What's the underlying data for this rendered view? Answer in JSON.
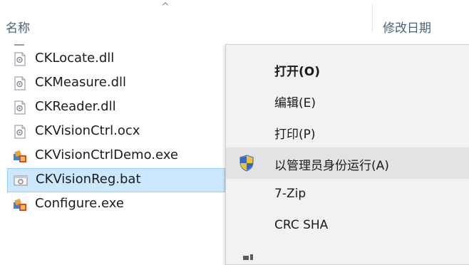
{
  "header": {
    "name_label": "名称",
    "date_label": "修改日期",
    "sort_glyph": "^"
  },
  "files": [
    {
      "name": "CKLocate.dll",
      "icon": "dll-file-icon"
    },
    {
      "name": "CKMeasure.dll",
      "icon": "dll-file-icon"
    },
    {
      "name": "CKReader.dll",
      "icon": "dll-file-icon"
    },
    {
      "name": "CKVisionCtrl.ocx",
      "icon": "ocx-file-icon"
    },
    {
      "name": "CKVisionCtrlDemo.exe",
      "icon": "exe-app-icon"
    },
    {
      "name": "CKVisionReg.bat",
      "icon": "bat-file-icon",
      "selected": true
    },
    {
      "name": "Configure.exe",
      "icon": "exe-app-icon"
    }
  ],
  "context_menu": {
    "items": [
      {
        "label": "打开(O)",
        "bold": true
      },
      {
        "label": "编辑(E)"
      },
      {
        "label": "打印(P)"
      },
      {
        "label": "以管理员身份运行(A)",
        "icon": "uac-shield-icon",
        "highlighted": true
      },
      {
        "label": "7-Zip"
      },
      {
        "label": "CRC SHA"
      }
    ]
  }
}
